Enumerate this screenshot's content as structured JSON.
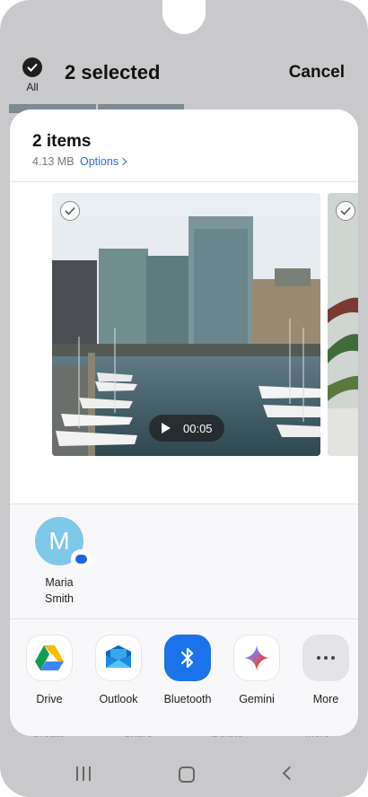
{
  "header": {
    "select_all_label": "All",
    "selection_title": "2 selected",
    "cancel_label": "Cancel"
  },
  "background_actions": [
    "Create",
    "Share",
    "Delete",
    "More"
  ],
  "share_sheet": {
    "title": "2 items",
    "size": "4.13 MB",
    "options_label": "Options",
    "video": {
      "duration": "00:05"
    },
    "contacts": [
      {
        "initial": "M",
        "name_line1": "Maria",
        "name_line2": "Smith",
        "badge": "messages-icon"
      }
    ],
    "apps": [
      {
        "label": "Drive",
        "icon": "google-drive-icon"
      },
      {
        "label": "Outlook",
        "icon": "outlook-icon"
      },
      {
        "label": "Bluetooth",
        "icon": "bluetooth-icon",
        "color": "#1a73e8"
      },
      {
        "label": "Gemini",
        "icon": "gemini-icon"
      },
      {
        "label": "More",
        "icon": "more-dots-icon"
      }
    ]
  },
  "navigation": [
    "recents-icon",
    "home-icon",
    "back-icon"
  ]
}
